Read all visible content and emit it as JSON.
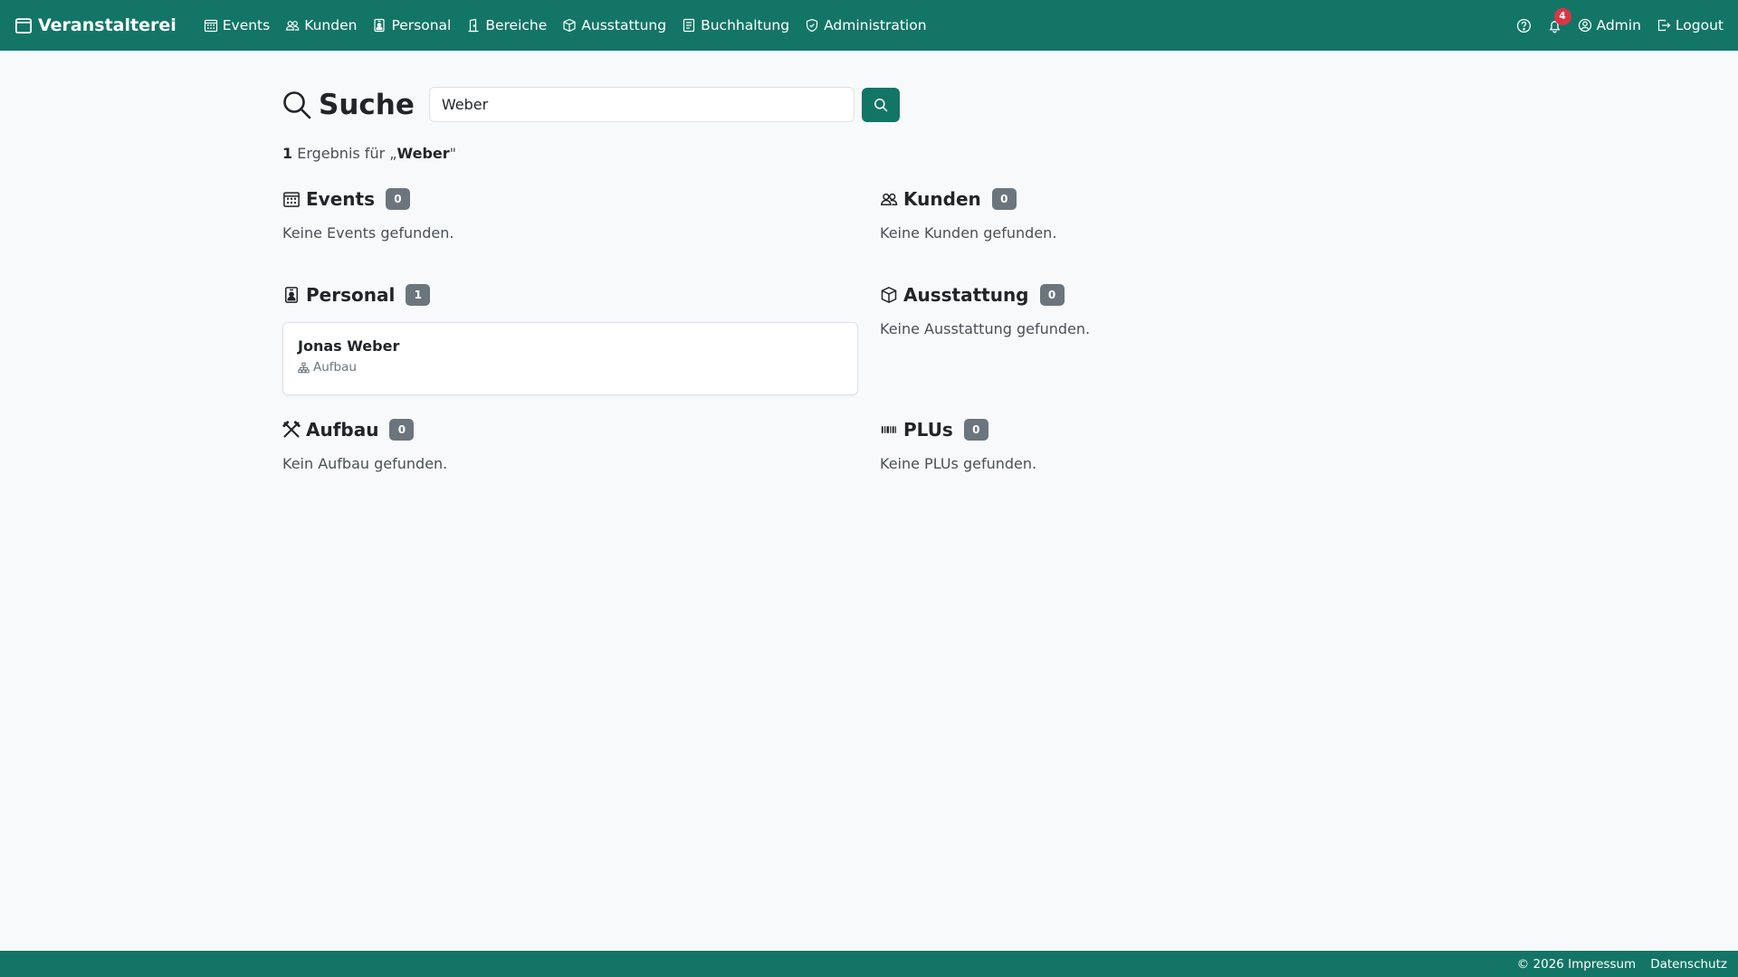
{
  "navbar": {
    "brand": "Veranstalterei",
    "items": [
      {
        "label": "Events",
        "icon": "calendar-grid-icon"
      },
      {
        "label": "Kunden",
        "icon": "people-icon"
      },
      {
        "label": "Personal",
        "icon": "person-badge-icon"
      },
      {
        "label": "Bereiche",
        "icon": "door-icon"
      },
      {
        "label": "Ausstattung",
        "icon": "box-icon"
      },
      {
        "label": "Buchhaltung",
        "icon": "journal-icon"
      },
      {
        "label": "Administration",
        "icon": "shield-icon"
      }
    ],
    "notifications_count": "4",
    "user_label": "Admin",
    "logout_label": "Logout"
  },
  "search": {
    "title": "Suche",
    "query": "Weber",
    "summary_count": "1",
    "summary_text": "Ergebnis für „",
    "summary_term": "Weber",
    "summary_close": "\""
  },
  "sections": {
    "events": {
      "title": "Events",
      "count": "0",
      "empty": "Keine Events gefunden."
    },
    "kunden": {
      "title": "Kunden",
      "count": "0",
      "empty": "Keine Kunden gefunden."
    },
    "personal": {
      "title": "Personal",
      "count": "1",
      "results": [
        {
          "name": "Jonas Weber",
          "area": "Aufbau"
        }
      ]
    },
    "ausstattung": {
      "title": "Ausstattung",
      "count": "0",
      "empty": "Keine Ausstattung gefunden."
    },
    "aufbau": {
      "title": "Aufbau",
      "count": "0",
      "empty": "Kein Aufbau gefunden."
    },
    "plus": {
      "title": "PLUs",
      "count": "0",
      "empty": "Keine PLUs gefunden."
    }
  },
  "footer": {
    "impressum": "© 2026 Impressum",
    "datenschutz": "Datenschutz"
  },
  "colors": {
    "primary": "#137566",
    "badge": "#6c757d",
    "notification": "#dc3545",
    "background": "#f8f9fa"
  }
}
